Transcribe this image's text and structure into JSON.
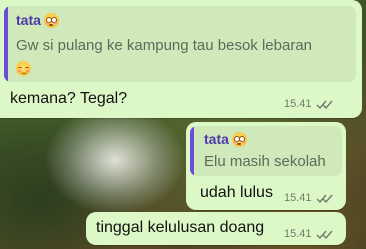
{
  "messages": [
    {
      "quote_author": "tata",
      "quote_author_emoji": "flushed-face-icon",
      "quote_text": "Gw si pulang ke kampung tau besok lebaran",
      "quote_text_emoji": "relieved-face-icon",
      "text": "kemana? Tegal?",
      "time": "15.41",
      "status_icon": "double-check-icon"
    },
    {
      "quote_author": "tata",
      "quote_author_emoji": "flushed-face-icon",
      "quote_text": "Elu masih sekolah",
      "text": "udah lulus",
      "time": "15.41",
      "status_icon": "double-check-icon"
    },
    {
      "text": "tinggal kelulusan doang",
      "time": "15.41",
      "status_icon": "double-check-icon"
    }
  ],
  "colors": {
    "bubble": "#dcf8c6",
    "quote_bar": "#6a4fd6",
    "quote_author": "#4b3aa8"
  }
}
